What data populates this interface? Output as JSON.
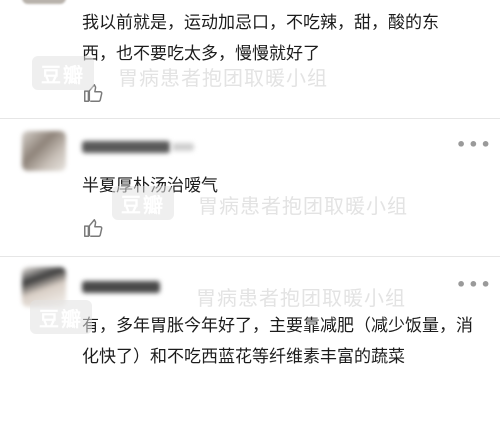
{
  "watermark": {
    "logo": "豆瓣",
    "group": "胃病患者抱团取暖小组"
  },
  "comments": [
    {
      "text": "我以前就是，运动加忌口，不吃辣，甜，酸的东西，也不要吃太多，慢慢就好了",
      "like_icon": "thumbs-up-icon"
    },
    {
      "text": "半夏厚朴汤治嗳气",
      "like_icon": "thumbs-up-icon",
      "more_icon": "more-dots-icon"
    },
    {
      "text": "有，多年胃胀今年好了，主要靠减肥（减少饭量，消化快了）和不吃西蓝花等纤维素丰富的蔬菜",
      "more_icon": "more-dots-icon"
    }
  ]
}
